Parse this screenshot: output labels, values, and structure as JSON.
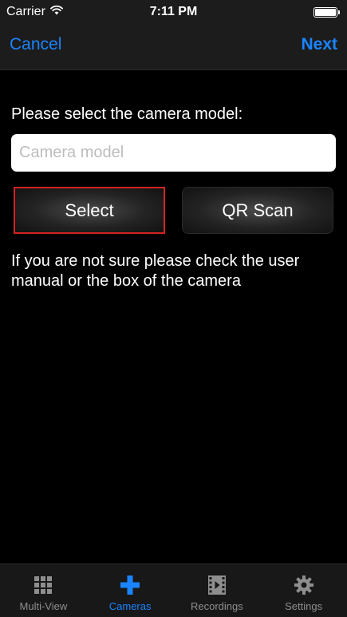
{
  "status_bar": {
    "carrier": "Carrier",
    "time": "7:11 PM",
    "battery_level": 1.0
  },
  "nav": {
    "cancel_label": "Cancel",
    "next_label": "Next"
  },
  "content": {
    "prompt": "Please select the camera model:",
    "camera_model": {
      "value": "",
      "placeholder": "Camera model"
    },
    "select_label": "Select",
    "qr_scan_label": "QR Scan",
    "hint": "If you are not sure please check the user manual or the box of the camera"
  },
  "tabs": [
    {
      "label": "Multi-View",
      "icon": "grid-icon",
      "active": false
    },
    {
      "label": "Cameras",
      "icon": "plus-icon",
      "active": true
    },
    {
      "label": "Recordings",
      "icon": "film-icon",
      "active": false
    },
    {
      "label": "Settings",
      "icon": "gear-icon",
      "active": false
    }
  ],
  "colors": {
    "accent": "#1a84ff",
    "selected_border": "#d32222",
    "inactive_tab": "#8e8e8e"
  }
}
